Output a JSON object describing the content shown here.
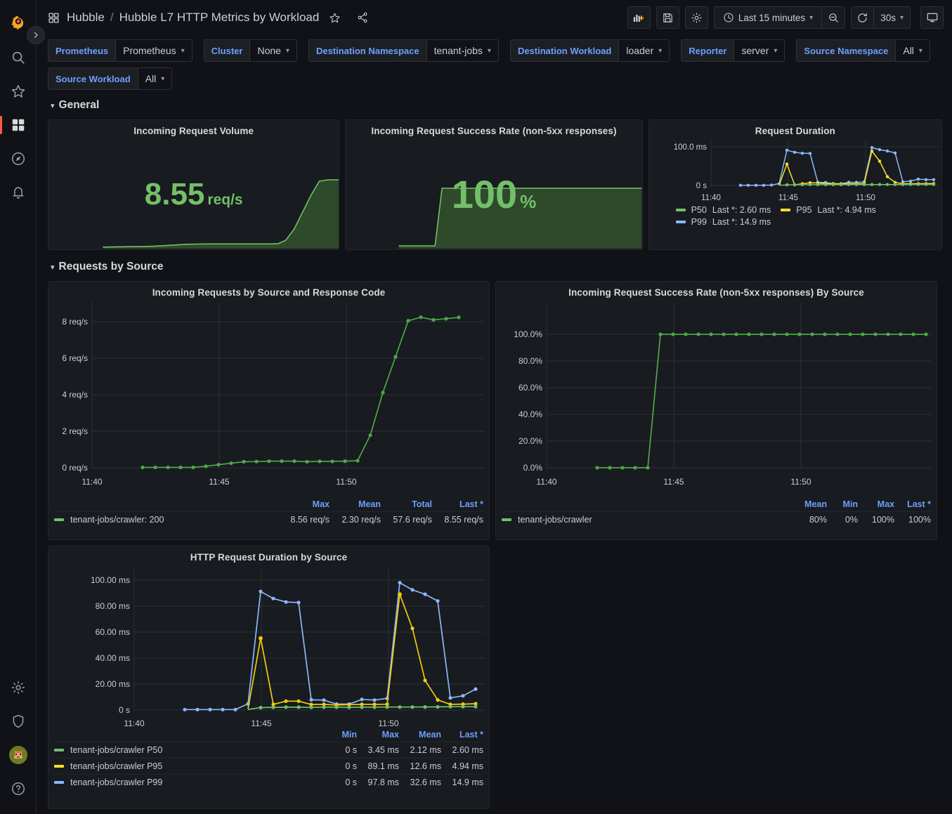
{
  "sidebar": {
    "items": [
      {
        "name": "grafana-logo-icon",
        "label": "Grafana"
      },
      {
        "name": "search-icon",
        "label": "Search"
      },
      {
        "name": "star-icon",
        "label": "Starred"
      },
      {
        "name": "dashboards-icon",
        "label": "Dashboards"
      },
      {
        "name": "compass-icon",
        "label": "Explore"
      },
      {
        "name": "bell-icon",
        "label": "Alerting"
      },
      {
        "name": "gear-icon",
        "label": "Configuration"
      },
      {
        "name": "shield-icon",
        "label": "Server Admin"
      },
      {
        "name": "avatar",
        "label": "Profile"
      },
      {
        "name": "help-icon",
        "label": "Help"
      }
    ],
    "expand_label": "Expand navigation"
  },
  "topnav": {
    "breadcrumb_root": "Hubble",
    "breadcrumb_sep": "/",
    "breadcrumb_current": "Hubble L7 HTTP Metrics by Workload",
    "star_label": "Mark as favorite",
    "share_label": "Share dashboard",
    "add_panel_label": "Add panel",
    "save_label": "Save dashboard",
    "settings_label": "Dashboard settings",
    "time_range": "Last 15 minutes",
    "zoom_out_label": "Zoom out time range",
    "refresh_label": "Refresh dashboard",
    "refresh_interval": "30s",
    "tv_mode_label": "Cycle view mode"
  },
  "variables": [
    {
      "label": "Prometheus",
      "value": "Prometheus",
      "has_caret": true
    },
    {
      "label": "Cluster",
      "value": "None",
      "has_caret": true
    },
    {
      "label": "Destination Namespace",
      "value": "tenant-jobs",
      "has_caret": true
    },
    {
      "label": "Destination Workload",
      "value": "loader",
      "has_caret": true
    },
    {
      "label": "Reporter",
      "value": "server",
      "has_caret": true
    },
    {
      "label": "Source Namespace",
      "value": "All",
      "has_caret": true
    },
    {
      "label": "Source Workload",
      "value": "All",
      "has_caret": true
    }
  ],
  "rows": [
    {
      "title": "General",
      "collapsed": false
    },
    {
      "title": "Requests by Source",
      "collapsed": false
    }
  ],
  "colors": {
    "green": "#73BF69",
    "yellow": "#FADE2A",
    "blue": "#8AB8FF",
    "accent_blue": "#6E9FFF",
    "orange": "#F55F3E",
    "panel_bg": "#181B1F",
    "page_bg": "#111217",
    "grid": "#2C3235",
    "text": "#CCCCDC"
  },
  "panels": {
    "incoming_request_volume": {
      "title": "Incoming Request Volume",
      "value": "8.55",
      "unit": "req/s"
    },
    "incoming_request_success_rate": {
      "title": "Incoming Request Success Rate (non-5xx responses)",
      "value": "100",
      "unit": "%"
    },
    "request_duration": {
      "title": "Request Duration",
      "legend": [
        {
          "name": "P50",
          "stat": "Last *: 2.60 ms",
          "color": "#73BF69"
        },
        {
          "name": "P95",
          "stat": "Last *: 4.94 ms",
          "color": "#FADE2A"
        },
        {
          "name": "P99",
          "stat": "Last *: 14.9 ms",
          "color": "#8AB8FF"
        }
      ]
    },
    "requests_by_source_code": {
      "title": "Incoming Requests by Source and Response Code",
      "legend_columns": [
        "Max",
        "Mean",
        "Total",
        "Last *"
      ],
      "legend_rows": [
        {
          "name": "tenant-jobs/crawler: 200",
          "color": "#73BF69",
          "values": [
            "8.56 req/s",
            "2.30 req/s",
            "57.6 req/s",
            "8.55 req/s"
          ]
        }
      ]
    },
    "success_rate_by_source": {
      "title": "Incoming Request Success Rate (non-5xx responses) By Source",
      "legend_columns": [
        "Mean",
        "Min",
        "Max",
        "Last *"
      ],
      "legend_rows": [
        {
          "name": "tenant-jobs/crawler",
          "color": "#73BF69",
          "values": [
            "80%",
            "0%",
            "100%",
            "100%"
          ]
        }
      ]
    },
    "duration_by_source": {
      "title": "HTTP Request Duration by Source",
      "legend_columns": [
        "Min",
        "Max",
        "Mean",
        "Last *"
      ],
      "legend_rows": [
        {
          "name": "tenant-jobs/crawler P50",
          "color": "#73BF69",
          "values": [
            "0 s",
            "3.45 ms",
            "2.12 ms",
            "2.60 ms"
          ]
        },
        {
          "name": "tenant-jobs/crawler P95",
          "color": "#FADE2A",
          "values": [
            "0 s",
            "89.1 ms",
            "12.6 ms",
            "4.94 ms"
          ]
        },
        {
          "name": "tenant-jobs/crawler P99",
          "color": "#8AB8FF",
          "values": [
            "0 s",
            "97.8 ms",
            "32.6 ms",
            "14.9 ms"
          ]
        }
      ]
    }
  },
  "chart_data": [
    {
      "id": "incoming_request_volume_spark",
      "type": "area",
      "title": "Incoming Request Volume",
      "xlabel": "",
      "ylabel": "req/s",
      "grid": false,
      "legend": "none",
      "x": [
        0,
        1,
        2,
        3,
        4,
        5,
        6,
        7,
        8,
        9,
        10,
        11,
        12,
        13,
        14,
        15,
        16,
        17,
        18,
        19,
        20,
        21,
        22,
        23,
        24,
        25,
        26,
        27
      ],
      "values": [
        0.01,
        0.02,
        0.03,
        0.04,
        0.05,
        0.08,
        0.15,
        0.22,
        0.3,
        0.33,
        0.35,
        0.35,
        0.35,
        0.35,
        0.35,
        0.35,
        0.35,
        0.36,
        0.36,
        0.4,
        1.8,
        4.1,
        6.1,
        8.05,
        8.56,
        8.45,
        8.5,
        8.55
      ],
      "ylim": [
        0,
        8.6
      ]
    },
    {
      "id": "incoming_request_success_rate_spark",
      "type": "area",
      "title": "Incoming Request Success Rate (non-5xx responses)",
      "xlabel": "",
      "ylabel": "%",
      "grid": false,
      "legend": "none",
      "x": [
        0,
        1,
        2,
        3,
        4,
        5,
        6,
        7,
        8,
        9,
        10,
        11,
        12,
        13,
        14,
        15,
        16,
        17,
        18,
        19,
        20,
        21,
        22,
        23,
        24,
        25,
        26,
        27
      ],
      "values": [
        0,
        0,
        0,
        0,
        0,
        100,
        100,
        100,
        100,
        100,
        100,
        100,
        100,
        100,
        100,
        100,
        100,
        100,
        100,
        100,
        100,
        100,
        100,
        100,
        100,
        100,
        100,
        100
      ],
      "ylim": [
        0,
        100
      ]
    },
    {
      "id": "request_duration",
      "type": "line",
      "title": "Request Duration",
      "xlabel": "",
      "ylabel": "",
      "ytick_labels": [
        "0 s",
        "100.0 ms"
      ],
      "ylim": [
        0,
        100
      ],
      "xtick_labels": [
        "11:40",
        "11:45",
        "11:50"
      ],
      "grid": true,
      "legend": "bottom",
      "x": [
        0,
        1,
        2,
        3,
        4,
        5,
        6,
        7,
        8,
        9,
        10,
        11,
        12,
        13,
        14,
        15,
        16,
        17,
        18,
        19,
        20,
        21,
        22,
        23,
        24,
        25,
        26,
        27,
        28,
        29
      ],
      "series": [
        {
          "name": "P50",
          "color": "#73BF69",
          "values": [
            null,
            null,
            null,
            null,
            null,
            0.5,
            1.4,
            1.8,
            2.0,
            2.1,
            2.0,
            2.1,
            2.1,
            2.0,
            2.1,
            2.1,
            2.2,
            2.2,
            2.2,
            2.2,
            2.3,
            2.3,
            2.3,
            2.3,
            2.3,
            2.4,
            2.5,
            2.5,
            2.6,
            2.6
          ]
        },
        {
          "name": "P95",
          "color": "#FADE2A",
          "values": [
            null,
            null,
            null,
            null,
            null,
            1.0,
            55.3,
            1.5,
            4.5,
            6.8,
            6.4,
            4.3,
            4.4,
            3.9,
            4.2,
            4.4,
            4.4,
            4.3,
            4.4,
            89.1,
            62.0,
            22.5,
            7.8,
            4.3,
            4.4,
            4.5,
            4.6,
            4.7,
            4.9,
            4.94
          ]
        },
        {
          "name": "P99",
          "color": "#8AB8FF",
          "values": [
            0.4,
            0.4,
            0.4,
            0.4,
            0.6,
            4.7,
            91.3,
            85.8,
            83.2,
            82.8,
            7.9,
            7.8,
            4.6,
            4.6,
            8.2,
            7.7,
            9.1,
            98.0,
            92.5,
            88.8,
            83.9,
            9.4,
            11.0,
            16.2,
            14.9,
            14.9,
            14.9,
            14.9,
            14.9,
            14.9
          ]
        }
      ]
    },
    {
      "id": "requests_by_source_code",
      "type": "line",
      "title": "Incoming Requests by Source and Response Code",
      "xlabel": "",
      "ylabel": "req/s",
      "ytick_labels": [
        "0 req/s",
        "2 req/s",
        "4 req/s",
        "6 req/s",
        "8 req/s"
      ],
      "yticks": [
        0,
        2,
        4,
        6,
        8
      ],
      "ylim": [
        0,
        9
      ],
      "xtick_labels": [
        "11:40",
        "11:45",
        "11:50"
      ],
      "grid": true,
      "legend": "table-bottom",
      "x": [
        0,
        1,
        2,
        3,
        4,
        5,
        6,
        7,
        8,
        9,
        10,
        11,
        12,
        13,
        14,
        15,
        16,
        17,
        18,
        19,
        20,
        21,
        22,
        23,
        24,
        25,
        26,
        27
      ],
      "series": [
        {
          "name": "tenant-jobs/crawler: 200",
          "color": "#73BF69",
          "values": [
            0.02,
            0.02,
            0.02,
            0.02,
            0.02,
            0.08,
            0.17,
            0.25,
            0.33,
            0.34,
            0.36,
            0.36,
            0.36,
            0.33,
            0.35,
            0.35,
            0.36,
            0.38,
            1.78,
            4.12,
            6.08,
            8.05,
            8.56,
            8.42,
            8.48,
            8.55,
            null,
            null
          ]
        }
      ]
    },
    {
      "id": "success_rate_by_source",
      "type": "line",
      "title": "Incoming Request Success Rate (non-5xx responses) By Source",
      "xlabel": "",
      "ylabel": "%",
      "ytick_labels": [
        "0.0%",
        "20.0%",
        "40.0%",
        "60.0%",
        "80.0%",
        "100.0%"
      ],
      "yticks": [
        0,
        20,
        40,
        60,
        80,
        100
      ],
      "ylim": [
        0,
        107
      ],
      "xtick_labels": [
        "11:40",
        "11:45",
        "11:50"
      ],
      "grid": true,
      "legend": "table-bottom",
      "x": [
        0,
        1,
        2,
        3,
        4,
        5,
        6,
        7,
        8,
        9,
        10,
        11,
        12,
        13,
        14,
        15,
        16,
        17,
        18,
        19,
        20,
        21,
        22,
        23,
        24,
        25,
        26,
        27,
        28,
        29,
        30,
        31,
        32
      ],
      "series": [
        {
          "name": "tenant-jobs/crawler",
          "color": "#73BF69",
          "values": [
            0,
            0,
            0,
            0,
            0,
            100,
            100,
            100,
            100,
            100,
            100,
            100,
            100,
            100,
            100,
            100,
            100,
            100,
            100,
            100,
            100,
            100,
            100,
            100,
            100,
            100,
            100,
            100,
            100,
            100,
            100,
            100,
            100
          ]
        }
      ]
    },
    {
      "id": "duration_by_source",
      "type": "line",
      "title": "HTTP Request Duration by Source",
      "xlabel": "",
      "ylabel": "ms",
      "ytick_labels": [
        "0 s",
        "20.00 ms",
        "40.00 ms",
        "60.00 ms",
        "80.00 ms",
        "100.00 ms"
      ],
      "yticks": [
        0,
        20,
        40,
        60,
        80,
        100
      ],
      "ylim": [
        0,
        105
      ],
      "xtick_labels": [
        "11:40",
        "11:45",
        "11:50"
      ],
      "grid": true,
      "legend": "table-bottom",
      "x": [
        0,
        1,
        2,
        3,
        4,
        5,
        6,
        7,
        8,
        9,
        10,
        11,
        12,
        13,
        14,
        15,
        16,
        17,
        18,
        19,
        20,
        21,
        22,
        23,
        24,
        25,
        26,
        27,
        28,
        29
      ],
      "series": [
        {
          "name": "tenant-jobs/crawler P50",
          "color": "#73BF69",
          "values": [
            null,
            null,
            null,
            null,
            null,
            0.5,
            1.9,
            2.1,
            2.2,
            2.2,
            2.1,
            2.2,
            2.2,
            2.1,
            2.2,
            2.2,
            2.3,
            2.3,
            2.3,
            2.3,
            2.3,
            2.4,
            2.4,
            2.5,
            2.5,
            2.6,
            2.6,
            2.6,
            2.6,
            2.6
          ]
        },
        {
          "name": "tenant-jobs/crawler P95",
          "color": "#FADE2A",
          "values": [
            null,
            null,
            null,
            null,
            null,
            1.0,
            55.3,
            4.4,
            6.9,
            6.4,
            4.3,
            4.4,
            3.9,
            4.2,
            4.4,
            4.4,
            4.3,
            4.4,
            4.5,
            89.1,
            62.8,
            22.8,
            7.8,
            4.3,
            4.4,
            4.5,
            4.6,
            4.7,
            4.8,
            4.94
          ]
        },
        {
          "name": "tenant-jobs/crawler P99",
          "color": "#8AB8FF",
          "values": [
            0.4,
            0.4,
            0.4,
            0.4,
            0.4,
            4.8,
            91.3,
            85.8,
            83.2,
            82.8,
            7.9,
            7.8,
            4.6,
            4.6,
            8.2,
            7.7,
            9.1,
            97.8,
            92.5,
            88.8,
            83.9,
            9.4,
            11.0,
            16.2,
            14.9,
            null,
            null,
            null,
            null,
            null
          ]
        }
      ]
    }
  ]
}
